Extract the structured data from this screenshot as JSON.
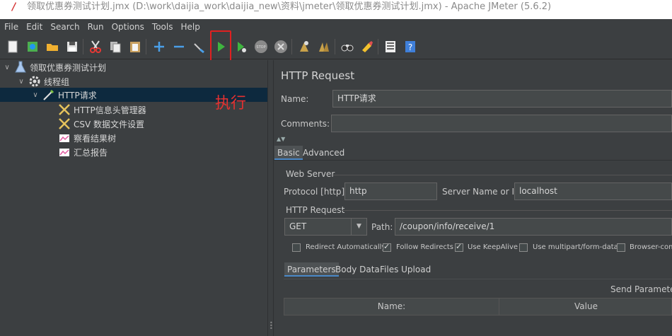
{
  "window": {
    "title": "领取优惠券测试计划.jmx (D:\\work\\daijia_work\\daijia_new\\资料\\jmeter\\领取优惠券测试计划.jmx) - Apache JMeter (5.6.2)"
  },
  "menu": [
    "File",
    "Edit",
    "Search",
    "Run",
    "Options",
    "Tools",
    "Help"
  ],
  "toolbar": {
    "icons": [
      "new-icon",
      "templates-icon",
      "open-icon",
      "save-icon",
      "cut-icon",
      "copy-icon",
      "paste-icon",
      "expand-icon",
      "collapse-icon",
      "toggle-icon",
      "start-icon",
      "start-no-pauses-icon",
      "stop-icon",
      "shutdown-icon",
      "clear-icon",
      "clear-all-icon",
      "search-icon",
      "reset-search-icon",
      "function-helper-icon",
      "help-icon"
    ],
    "annotation": "执行",
    "highlight_color": "#e02020"
  },
  "tree": {
    "items": [
      {
        "label": "领取优惠券测试计划",
        "icon": "test-plan-icon"
      },
      {
        "label": "线程组",
        "icon": "thread-group-gear-icon"
      },
      {
        "label": "HTTP请求",
        "icon": "http-sampler-pipette-icon"
      },
      {
        "label": "HTTP信息头管理器",
        "icon": "config-tool-icon"
      },
      {
        "label": "CSV 数据文件设置",
        "icon": "config-tool-icon"
      },
      {
        "label": "察看结果树",
        "icon": "listener-chart-icon"
      },
      {
        "label": "汇总报告",
        "icon": "listener-chart-icon"
      }
    ]
  },
  "panel": {
    "title": "HTTP Request",
    "name_label": "Name:",
    "name_value": "HTTP请求",
    "comments_label": "Comments:",
    "tabs": [
      "Basic",
      "Advanced"
    ],
    "web_server_label": "Web Server",
    "protocol_label": "Protocol [http]:",
    "protocol_value": "http",
    "server_label": "Server Name or IP:",
    "server_value": "localhost",
    "http_request_label": "HTTP Request",
    "method_value": "GET",
    "path_label": "Path:",
    "path_value": "/coupon/info/receive/1",
    "checkboxes": [
      {
        "label": "Redirect Automatically",
        "checked": false
      },
      {
        "label": "Follow Redirects",
        "checked": true
      },
      {
        "label": "Use KeepAlive",
        "checked": true
      },
      {
        "label": "Use multipart/form-data",
        "checked": false
      },
      {
        "label": "Browser-comp",
        "checked": false
      }
    ],
    "sub_tabs": [
      "Parameters",
      "Body Data",
      "Files Upload"
    ],
    "send_params_label": "Send Parameters",
    "columns": [
      "Name:",
      "Value"
    ]
  }
}
